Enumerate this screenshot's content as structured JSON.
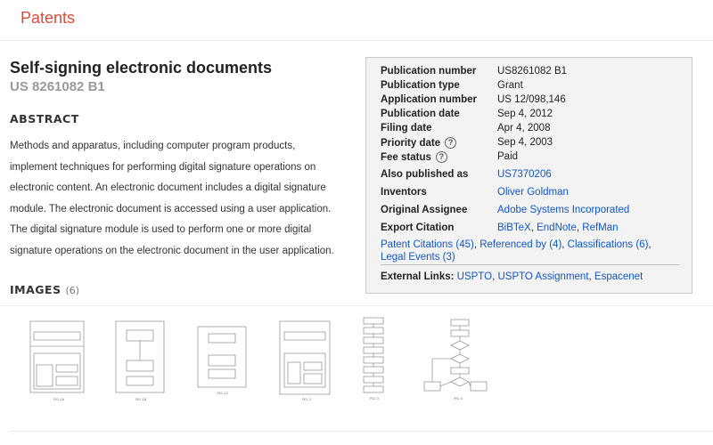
{
  "header": {
    "brand": "Patents"
  },
  "patent": {
    "title": "Self-signing electronic documents",
    "number": "US 8261082 B1"
  },
  "abstract": {
    "heading": "ABSTRACT",
    "text": "Methods and apparatus, including computer program products, implement techniques for performing digital signature operations on electronic content. An electronic document includes a digital signature module. The electronic document is accessed using a user application. The digital signature module is used to perform one or more digital signature operations on the electronic document in the user application."
  },
  "info": {
    "publication_number": {
      "label": "Publication number",
      "value": "US8261082 B1"
    },
    "publication_type": {
      "label": "Publication type",
      "value": "Grant"
    },
    "application_number": {
      "label": "Application number",
      "value": "US 12/098,146"
    },
    "publication_date": {
      "label": "Publication date",
      "value": "Sep 4, 2012"
    },
    "filing_date": {
      "label": "Filing date",
      "value": "Apr 4, 2008"
    },
    "priority_date": {
      "label": "Priority date",
      "value": "Sep 4, 2003"
    },
    "fee_status": {
      "label": "Fee status",
      "value": "Paid"
    },
    "also_published": {
      "label": "Also published as",
      "value": "US7370206"
    },
    "inventors": {
      "label": "Inventors",
      "value": "Oliver Goldman"
    },
    "assignee": {
      "label": "Original Assignee",
      "value": "Adobe Systems Incorporated"
    },
    "export": {
      "label": "Export Citation",
      "links": [
        "BiBTeX",
        "EndNote",
        "RefMan"
      ]
    },
    "help_glyph": "?",
    "citations": {
      "patent_citations": "Patent Citations (45)",
      "referenced_by": "Referenced by (4)",
      "classifications": "Classifications (6)",
      "legal_events": "Legal Events (3)"
    },
    "external": {
      "label": "External Links:",
      "links": [
        "USPTO",
        "USPTO Assignment",
        "Espacenet"
      ]
    }
  },
  "images": {
    "heading": "IMAGES",
    "count": "(6)",
    "figures": [
      "FIG. 1A",
      "FIG. 1B",
      "FIG. 1C",
      "FIG. 2",
      "FIG. 3",
      "FIG. 4"
    ]
  },
  "colors": {
    "brand": "#dd4b39",
    "link": "#1155cc",
    "visited": "#660099",
    "infobox_bg": "#f3f3f3"
  }
}
